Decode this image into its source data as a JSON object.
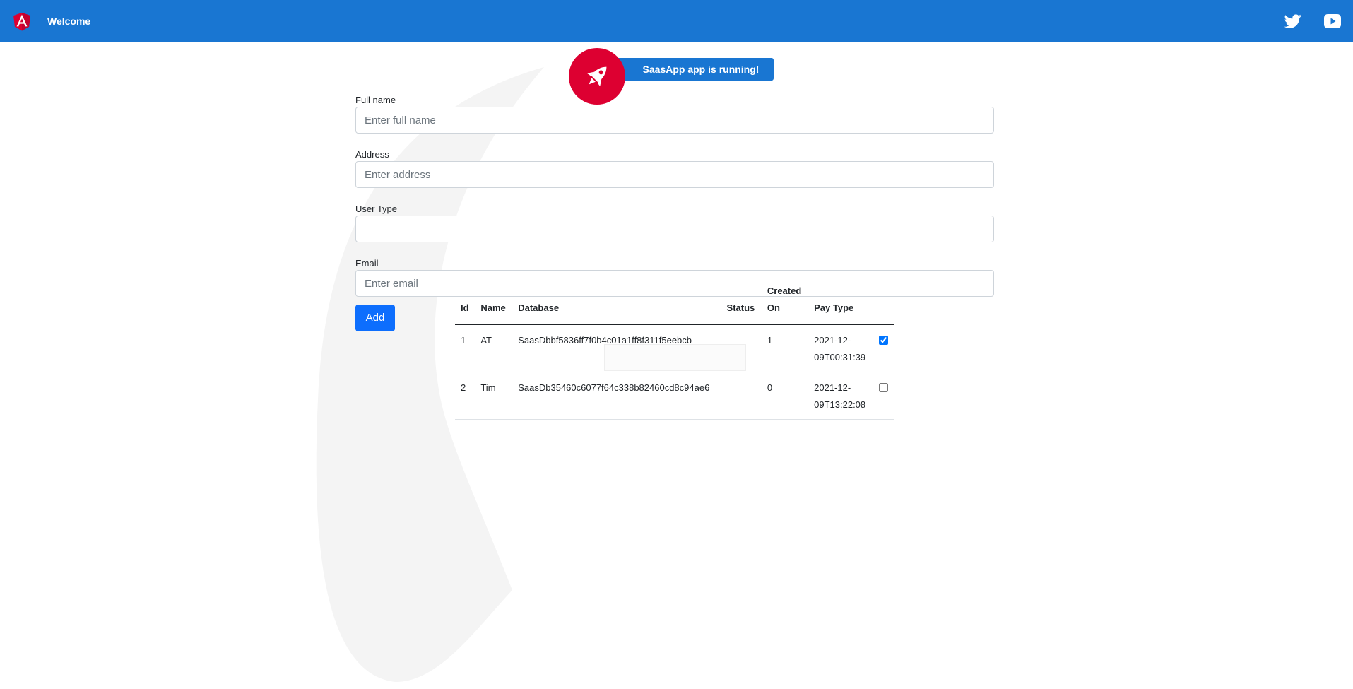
{
  "header": {
    "title": "Welcome",
    "logo_icon": "angular-logo-icon",
    "links": [
      {
        "icon": "twitter-icon"
      },
      {
        "icon": "youtube-icon"
      }
    ],
    "background_color": "#1976d2"
  },
  "banner": {
    "text": "SaasApp app is running!",
    "icon": "rocket-icon",
    "circle_color": "#dd0031"
  },
  "form": {
    "full_name": {
      "label": "Full name",
      "value": "",
      "placeholder": "Enter full name"
    },
    "address": {
      "label": "Address",
      "value": "",
      "placeholder": "Enter address"
    },
    "user_type": {
      "label": "User Type",
      "value": "",
      "placeholder": ""
    },
    "email": {
      "label": "Email",
      "value": "",
      "placeholder": "Enter email"
    },
    "add_label": "Add",
    "button_color": "#0d6efd"
  },
  "table": {
    "headers": {
      "id": "Id",
      "name": "Name",
      "database": "Database",
      "status": "Status",
      "created_on_1": "Created",
      "created_on_2": "On",
      "pay_type": "Pay Type"
    },
    "rows": [
      {
        "id": "1",
        "name": "AT",
        "database": "SaasDbbf5836ff7f0b4c01a1ff8f311f5eebcb",
        "status": "",
        "created_on": "1",
        "pay_type_1": "2021-12-",
        "pay_type_2": "09T00:31:39",
        "checked": true
      },
      {
        "id": "2",
        "name": "Tim",
        "database": "SaasDb35460c6077f64c338b82460cd8c94ae6",
        "status": "",
        "created_on": "0",
        "pay_type_1": "2021-12-",
        "pay_type_2": "09T13:22:08",
        "checked": false
      }
    ]
  }
}
